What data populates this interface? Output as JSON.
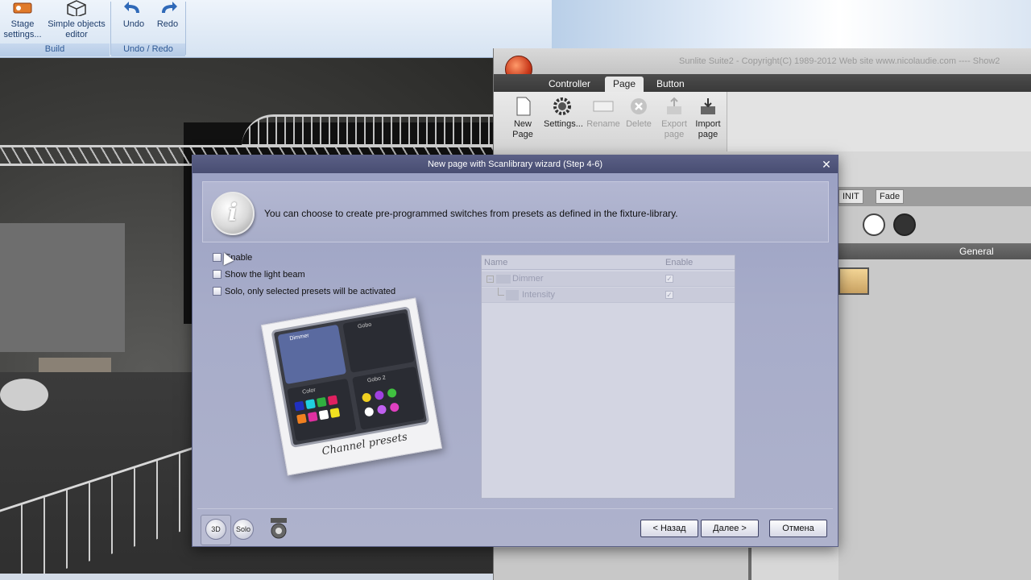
{
  "bg_app": {
    "ribbon": {
      "stage_settings": "Stage settings...",
      "simple_objects": "Simple objects editor",
      "undo": "Undo",
      "redo": "Redo",
      "group_build": "Build",
      "group_undo_redo": "Undo / Redo"
    }
  },
  "sunlite": {
    "title": "Sunlite Suite2 - Copyright(C) 1989-2012   Web site www.nicolaudie.com  ---- Show2",
    "tabs": [
      "Controller",
      "Page",
      "Button"
    ],
    "active_tab": "Page",
    "ribbon": {
      "new_page": "New Page",
      "settings": "Settings...",
      "rename": "Rename",
      "delete": "Delete",
      "export_page": "Export page",
      "import_page": "Import page"
    },
    "init_label": "INIT",
    "fade_label": "Fade",
    "general_label": "General"
  },
  "dialog": {
    "title": "New page with Scanlibrary wizard (Step 4-6)",
    "info_text": "You can choose to create pre-programmed switches from presets as defined in the fixture-library.",
    "options": [
      {
        "label": "Enable",
        "checked": false
      },
      {
        "label": "Show the light beam",
        "checked": false
      },
      {
        "label": "Solo, only selected presets will be activated",
        "checked": false
      }
    ],
    "tree": {
      "col_name": "Name",
      "col_enable": "Enable",
      "rows": [
        {
          "label": "Dimmer",
          "checked": true,
          "level": 0
        },
        {
          "label": "Intensity",
          "checked": true,
          "level": 1
        }
      ]
    },
    "preset_image": {
      "caption": "Channel presets",
      "tiles": [
        "Dimmer",
        "Gobo",
        "Color",
        "Gobo 2"
      ]
    },
    "bottom_icons": {
      "three_d": "3D",
      "solo": "Solo"
    },
    "buttons": {
      "back": "< Назад",
      "next": "Далее >",
      "cancel": "Отмена"
    }
  }
}
